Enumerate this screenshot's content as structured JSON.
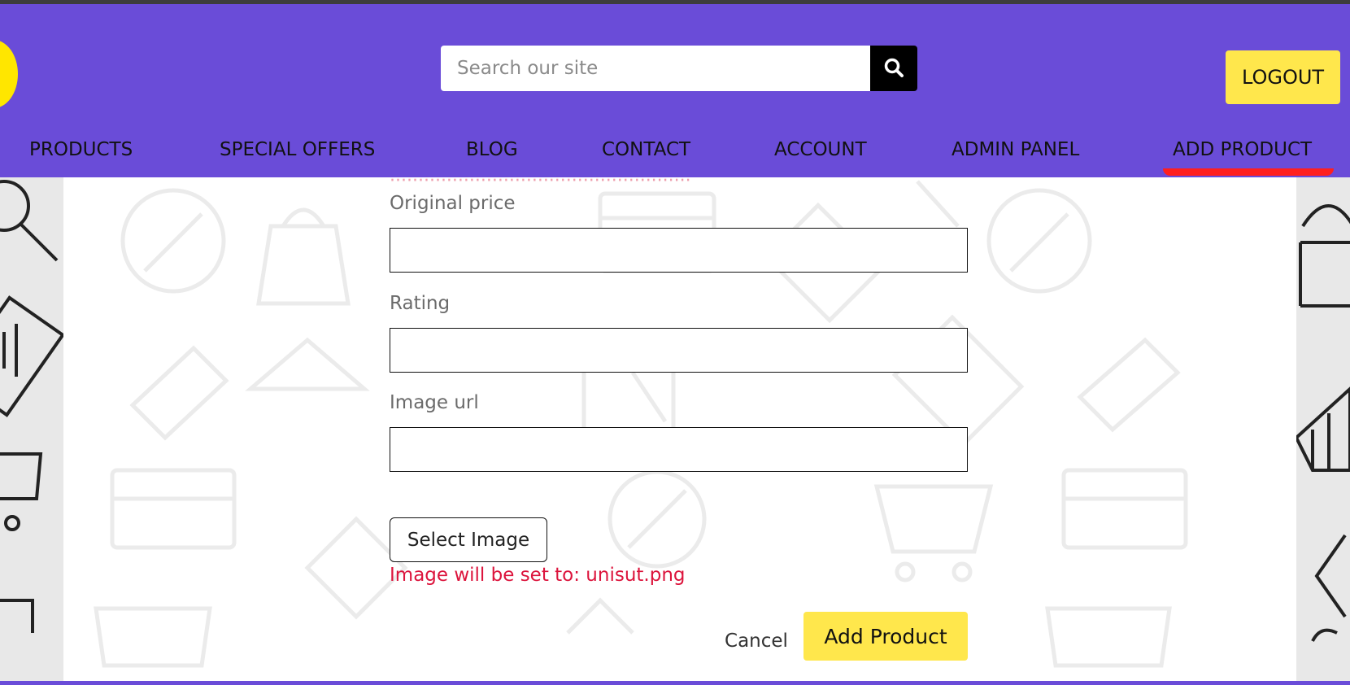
{
  "header": {
    "search_placeholder": "Search our site",
    "logout_label": "LOGOUT",
    "brand_color": "#6a4cd8",
    "accent_color": "#ffe74c"
  },
  "nav": {
    "items": [
      {
        "label": "PRODUCTS"
      },
      {
        "label": "SPECIAL OFFERS"
      },
      {
        "label": "BLOG"
      },
      {
        "label": "CONTACT"
      },
      {
        "label": "ACCOUNT"
      },
      {
        "label": "ADMIN PANEL"
      },
      {
        "label": "ADD PRODUCT",
        "active": true
      }
    ]
  },
  "form": {
    "original_price": {
      "label": "Original price",
      "value": ""
    },
    "rating": {
      "label": "Rating",
      "value": ""
    },
    "image_url": {
      "label": "Image url",
      "value": ""
    },
    "select_image_label": "Select Image",
    "image_note": "Image will be set to: unisut.png",
    "cancel_label": "Cancel",
    "submit_label": "Add Product",
    "error_color": "#dc143c"
  },
  "icons": [
    "search-icon"
  ]
}
